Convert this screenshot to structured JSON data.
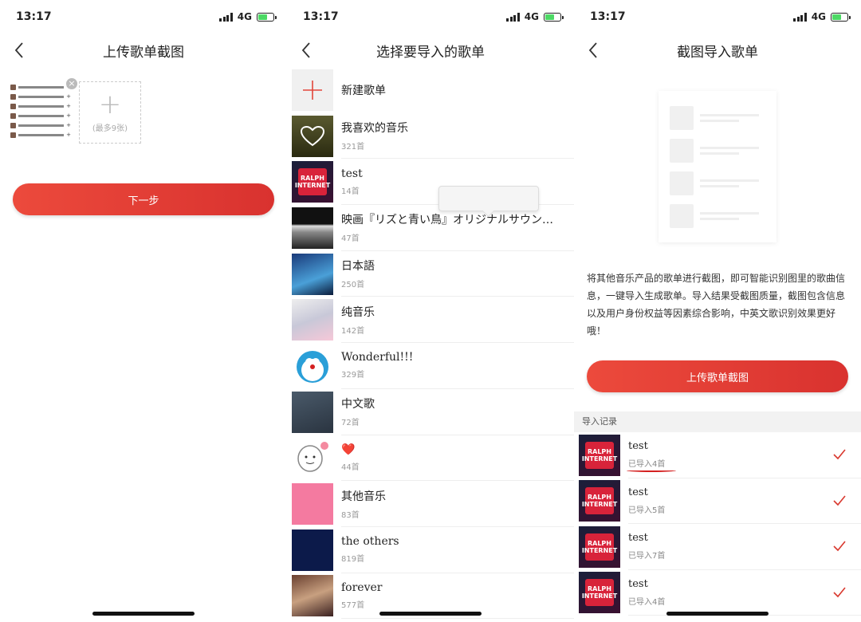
{
  "status": {
    "time": "13:17",
    "network": "4G"
  },
  "screen1": {
    "title": "上传歌单截图",
    "add_hint": "(最多9张)",
    "next_button": "下一步"
  },
  "screen2": {
    "title": "选择要导入的歌单",
    "new_playlist": "新建歌单",
    "playlists": [
      {
        "name": "我喜欢的音乐",
        "count": "321首"
      },
      {
        "name": "test",
        "count": "14首"
      },
      {
        "name": "映画『リズと青い鳥』オリジナルサウン…",
        "count": "47首"
      },
      {
        "name": "日本語",
        "count": "250首"
      },
      {
        "name": "纯音乐",
        "count": "142首"
      },
      {
        "name": "Wonderful!!!",
        "count": "329首"
      },
      {
        "name": "中文歌",
        "count": "72首"
      },
      {
        "name": "❤️",
        "count": "44首"
      },
      {
        "name": "其他音乐",
        "count": "83首"
      },
      {
        "name": "the others",
        "count": "819首"
      },
      {
        "name": "forever",
        "count": "577首"
      }
    ]
  },
  "screen3": {
    "title": "截图导入歌单",
    "description": "将其他音乐产品的歌单进行截图，即可智能识别图里的歌曲信息，一键导入生成歌单。导入结果受截图质量，截图包含信息以及用户身份权益等因素综合影响，中英文歌识别效果更好哦！",
    "upload_button": "上传歌单截图",
    "records_header": "导入记录",
    "records": [
      {
        "name": "test",
        "count": "已导入4首"
      },
      {
        "name": "test",
        "count": "已导入5首"
      },
      {
        "name": "test",
        "count": "已导入7首"
      },
      {
        "name": "test",
        "count": "已导入4首"
      }
    ]
  },
  "colors": {
    "accent": "#e23f35",
    "pink": "#f47aa0",
    "navy": "#0c1a4a"
  }
}
